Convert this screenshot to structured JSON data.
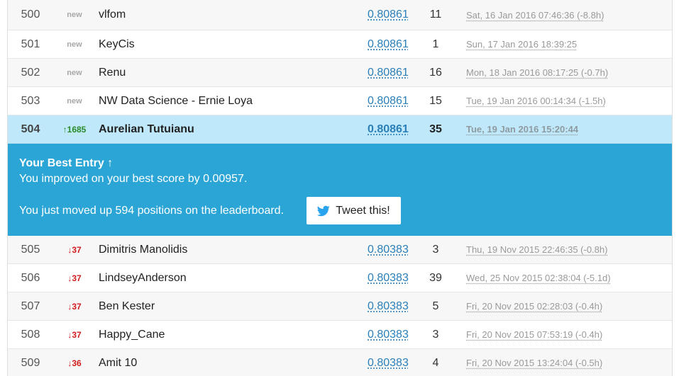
{
  "rows_before": [
    {
      "rank": "500",
      "delta": "new",
      "delta_type": "new",
      "team": "vlfom",
      "score": "0.80861",
      "entries": "11",
      "last": "Sat, 16 Jan 2016 07:46:36 (-8.8h)"
    },
    {
      "rank": "501",
      "delta": "new",
      "delta_type": "new",
      "team": "KeyCis",
      "score": "0.80861",
      "entries": "1",
      "last": "Sun, 17 Jan 2016 18:39:25"
    },
    {
      "rank": "502",
      "delta": "new",
      "delta_type": "new",
      "team": "Renu",
      "score": "0.80861",
      "entries": "16",
      "last": "Mon, 18 Jan 2016 08:17:25 (-0.7h)"
    },
    {
      "rank": "503",
      "delta": "new",
      "delta_type": "new",
      "team": "NW Data Science - Ernie Loya",
      "score": "0.80861",
      "entries": "15",
      "last": "Tue, 19 Jan 2016 00:14:34 (-1.5h)"
    }
  ],
  "highlight_row": {
    "rank": "504",
    "delta": "↑1685",
    "delta_type": "up",
    "team": "Aurelian Tutuianu",
    "score": "0.80861",
    "entries": "35",
    "last": "Tue, 19 Jan 2016 15:20:44"
  },
  "banner": {
    "title": "Your Best Entry ↑",
    "improved_text": "You improved on your best score by 0.00957.",
    "moved_text": "You just moved up 594 positions on the leaderboard.",
    "tweet_label": "Tweet this!",
    "bg_color": "#2ba5d6"
  },
  "rows_after": [
    {
      "rank": "505",
      "delta": "↓37",
      "delta_type": "down",
      "team": "Dimitris Manolidis",
      "score": "0.80383",
      "entries": "3",
      "last": "Thu, 19 Nov 2015 22:46:35 (-0.8h)"
    },
    {
      "rank": "506",
      "delta": "↓37",
      "delta_type": "down",
      "team": "LindseyAnderson",
      "score": "0.80383",
      "entries": "39",
      "last": "Wed, 25 Nov 2015 02:38:04 (-5.1d)"
    },
    {
      "rank": "507",
      "delta": "↓37",
      "delta_type": "down",
      "team": "Ben Kester",
      "score": "0.80383",
      "entries": "5",
      "last": "Fri, 20 Nov 2015 02:28:03 (-0.4h)"
    },
    {
      "rank": "508",
      "delta": "↓37",
      "delta_type": "down",
      "team": "Happy_Cane",
      "score": "0.80383",
      "entries": "3",
      "last": "Fri, 20 Nov 2015 07:53:19 (-0.4h)"
    },
    {
      "rank": "509",
      "delta": "↓36",
      "delta_type": "down",
      "team": "Amit 10",
      "score": "0.80383",
      "entries": "4",
      "last": "Fri, 20 Nov 2015 13:24:04 (-0.5h)"
    }
  ],
  "icons": {
    "tweet": "twitter-bird-icon"
  }
}
